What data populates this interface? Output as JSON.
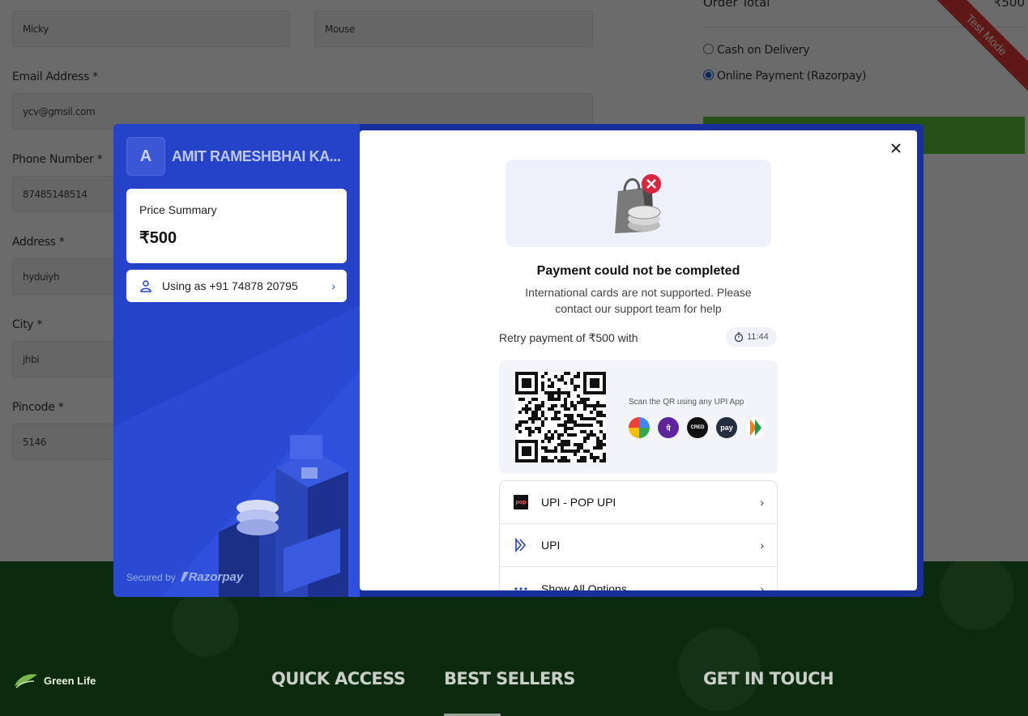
{
  "form": {
    "first_name": "Micky",
    "last_name": "Mouse",
    "email_label": "Email Address *",
    "email": "ycv@gmsil.com",
    "phone_label": "Phone Number *",
    "phone": "87485148514",
    "address_label": "Address *",
    "address": "hyduiyh",
    "city_label": "City *",
    "city": "jhbi",
    "pincode_label": "Pincode *",
    "pincode": "5146"
  },
  "order": {
    "total_label": "Order Total",
    "total_value": "₹500",
    "cod_label": "Cash on Delivery",
    "online_label": "Online Payment (Razorpay)",
    "selected": "online"
  },
  "ribbon": "Test Mode",
  "footer": {
    "logo": "Green Life",
    "quick_access": "QUICK ACCESS",
    "best_sellers": "BEST SELLERS",
    "get_in_touch": "GET IN TOUCH"
  },
  "checkout": {
    "merchant_initial": "A",
    "merchant_name": "AMIT RAMESHBHAI KA...",
    "price_summary_label": "Price Summary",
    "price": "₹500",
    "using_as": "Using as +91 74878 20795",
    "secured_by": "Secured by",
    "brand": "Razorpay",
    "error_title": "Payment could not be completed",
    "error_message": "International cards are not supported. Please contact our support team for help",
    "retry_text": "Retry payment of ₹500 with",
    "timer": "11:44",
    "qr_caption": "Scan the QR using any UPI App",
    "methods": [
      {
        "label": "UPI - POP UPI",
        "icon": "pop-upi-icon"
      },
      {
        "label": "UPI",
        "icon": "upi-icon"
      },
      {
        "label": "Show All Options",
        "icon": "more-icon"
      }
    ]
  },
  "colors": {
    "razorpay_dark": "#182f9c",
    "razorpay_side": "#2543c9",
    "ribbon": "#e53935",
    "place_order": "#5bbf3a",
    "footer": "#0b2a0e"
  }
}
